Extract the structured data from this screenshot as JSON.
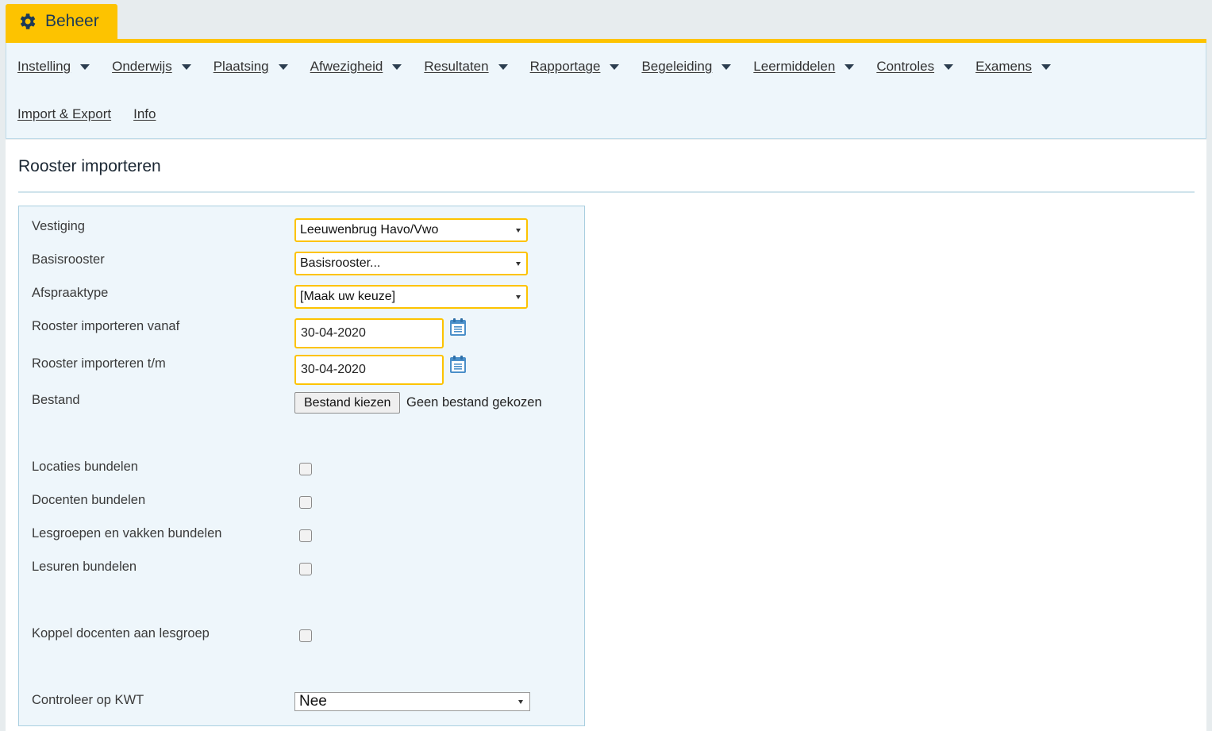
{
  "app": {
    "tab_label": "Beheer",
    "accent_color": "#fdc300",
    "tab_icon": "gear-icon"
  },
  "menu": {
    "row1": [
      {
        "label": "Instelling"
      },
      {
        "label": "Onderwijs"
      },
      {
        "label": "Plaatsing"
      },
      {
        "label": "Afwezigheid"
      },
      {
        "label": "Resultaten"
      },
      {
        "label": "Rapportage"
      },
      {
        "label": "Begeleiding"
      },
      {
        "label": "Leermiddelen"
      },
      {
        "label": "Controles"
      },
      {
        "label": "Examens"
      }
    ],
    "row2": [
      {
        "label": "Import & Export"
      },
      {
        "label": "Info"
      }
    ]
  },
  "page": {
    "title": "Rooster importeren"
  },
  "form": {
    "vestiging": {
      "label": "Vestiging",
      "value": "Leeuwenbrug Havo/Vwo"
    },
    "basisrooster": {
      "label": "Basisrooster",
      "value": "Basisrooster..."
    },
    "afspraaktype": {
      "label": "Afspraaktype",
      "value": "[Maak uw keuze]"
    },
    "vanaf": {
      "label": "Rooster importeren vanaf",
      "value": "30-04-2020",
      "icon": "calendar-icon"
    },
    "tm": {
      "label": "Rooster importeren t/m",
      "value": "30-04-2020",
      "icon": "calendar-icon"
    },
    "bestand": {
      "label": "Bestand",
      "button": "Bestand kiezen",
      "status": "Geen bestand gekozen"
    },
    "locaties": {
      "label": "Locaties bundelen",
      "checked": false
    },
    "docenten": {
      "label": "Docenten bundelen",
      "checked": false
    },
    "lesgroepen": {
      "label": "Lesgroepen en vakken bundelen",
      "checked": false
    },
    "lesuren": {
      "label": "Lesuren bundelen",
      "checked": false
    },
    "koppel": {
      "label": "Koppel docenten aan lesgroep",
      "checked": false
    },
    "kwt": {
      "label": "Controleer op KWT",
      "value": "Nee"
    }
  }
}
